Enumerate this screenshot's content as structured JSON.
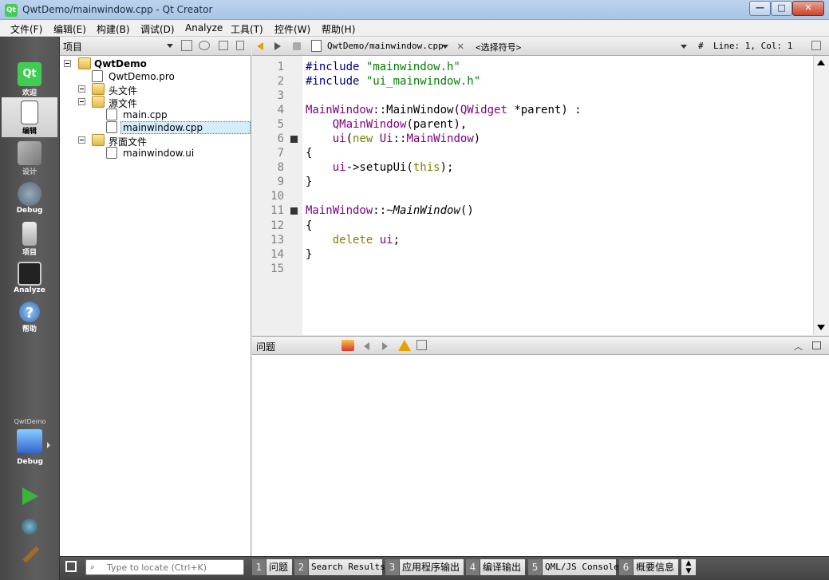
{
  "window": {
    "title": "QwtDemo/mainwindow.cpp - Qt Creator",
    "app_icon_text": "Qt",
    "minimize": "—",
    "maximize": "□",
    "close": "✕"
  },
  "menubar": {
    "items": [
      "文件(F)",
      "编辑(E)",
      "构建(B)",
      "调试(D)",
      "Analyze",
      "工具(T)",
      "控件(W)",
      "帮助(H)"
    ]
  },
  "modes": [
    {
      "label": "欢迎",
      "icon": "qt-logo-icon"
    },
    {
      "label": "编辑",
      "icon": "document-edit-icon",
      "active": true
    },
    {
      "label": "设计",
      "icon": "design-tools-icon"
    },
    {
      "label": "Debug",
      "icon": "debug-bug-icon"
    },
    {
      "label": "项目",
      "icon": "project-folder-icon"
    },
    {
      "label": "Analyze",
      "icon": "analyze-monitor-icon"
    },
    {
      "label": "帮助",
      "icon": "help-icon"
    }
  ],
  "kit": {
    "project": "QwtDemo",
    "build": "Debug"
  },
  "project_pane": {
    "title": "项目",
    "tree": [
      {
        "label": "QwtDemo",
        "bold": true
      },
      {
        "label": "QwtDemo.pro"
      },
      {
        "label": "头文件"
      },
      {
        "label": "源文件"
      },
      {
        "label": "main.cpp"
      },
      {
        "label": "mainwindow.cpp",
        "selected": true
      },
      {
        "label": "界面文件"
      },
      {
        "label": "mainwindow.ui"
      }
    ]
  },
  "editor": {
    "file": "QwtDemo/mainwindow.cpp",
    "symbol": "<选择符号>",
    "position": "Line: 1, Col: 1",
    "hash": "#",
    "line_numbers": [
      "1",
      "2",
      "3",
      "4",
      "5",
      "6",
      "7",
      "8",
      "9",
      "10",
      "11",
      "12",
      "13",
      "14",
      "15"
    ]
  },
  "issues": {
    "title": "问题"
  },
  "bottom": {
    "locator_placeholder": "Type to locate (Ctrl+K)",
    "tabs": [
      {
        "num": "1",
        "label": "问题"
      },
      {
        "num": "2",
        "label": "Search Results"
      },
      {
        "num": "3",
        "label": "应用程序输出"
      },
      {
        "num": "4",
        "label": "编译输出"
      },
      {
        "num": "5",
        "label": "QML/JS Console"
      },
      {
        "num": "6",
        "label": "概要信息"
      }
    ]
  }
}
